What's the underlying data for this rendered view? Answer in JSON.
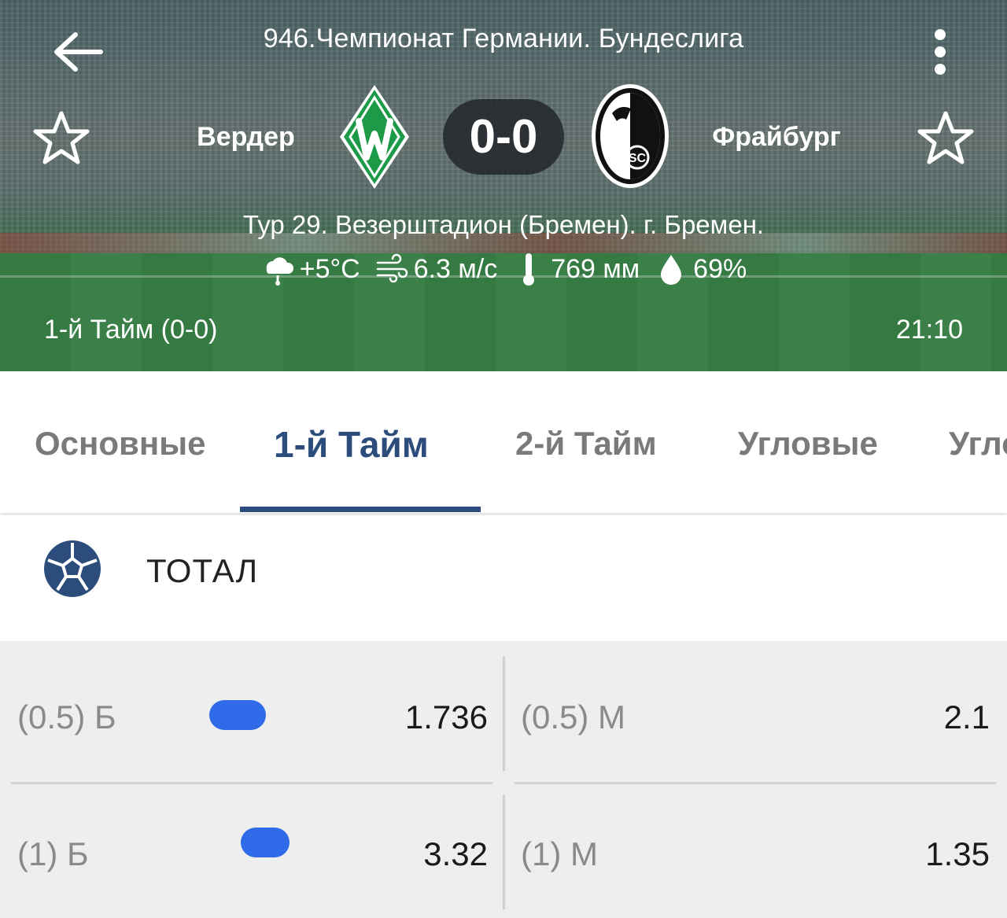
{
  "header": {
    "league_title": "946.Чемпионат Германии. Бундеслига",
    "home_team": "Вердер",
    "away_team": "Фрайбург",
    "score": "0-0",
    "venue": "Тур 29. Везерштадион (Бремен). г. Бремен.",
    "weather": {
      "temperature": "+5°C",
      "wind": "6.3 м/с",
      "pressure": "769 мм",
      "humidity": "69%",
      "icons": [
        "rain-cloud-icon",
        "wind-icon",
        "thermometer-icon",
        "droplet-icon"
      ]
    },
    "period": "1-й  Тайм (0-0)",
    "time": "21:10"
  },
  "tabs": [
    {
      "label": "Основные"
    },
    {
      "label": "1-й  Тайм",
      "active": true
    },
    {
      "label": "2-й  Тайм"
    },
    {
      "label": "Угловые"
    },
    {
      "label": "Угло"
    }
  ],
  "section": {
    "title": "ТОТАЛ",
    "icon": "soccer-ball-icon"
  },
  "odds": [
    {
      "over_label": "(0.5) Б",
      "over_value": "1.736",
      "under_label": "(0.5) М",
      "under_value": "2.1"
    },
    {
      "over_label": "(1) Б",
      "over_value": "3.32",
      "under_label": "(1) М",
      "under_value": "1.35"
    }
  ],
  "colors": {
    "accent": "#2c4c7c",
    "pill": "#2f6be8",
    "odds_bg": "#eeeeee"
  }
}
